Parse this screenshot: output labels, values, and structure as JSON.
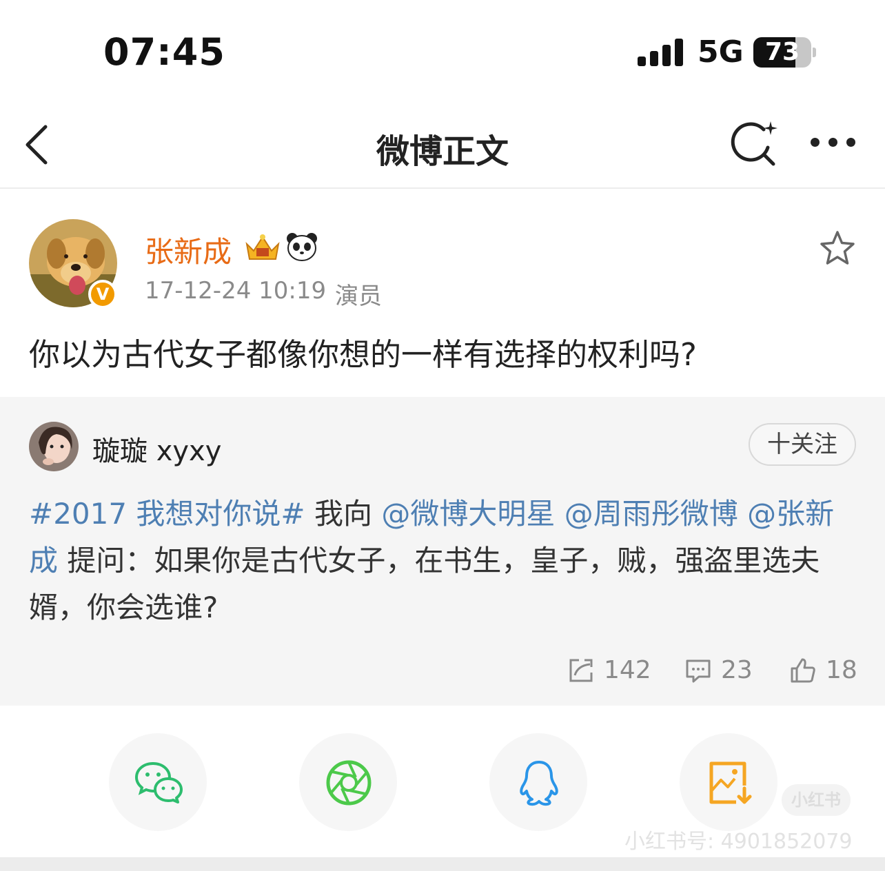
{
  "status_bar": {
    "time": "07:45",
    "network": "5G",
    "battery_level": "73",
    "battery_fraction": 0.73
  },
  "nav": {
    "title": "微博正文"
  },
  "post": {
    "author": "张新成",
    "verified_badge": "V",
    "timestamp": "17-12-24 10:19",
    "source": "演员",
    "text": "你以为古代女子都像你想的一样有选择的权利吗?"
  },
  "repost": {
    "author": "璇璇 xyxy",
    "follow_label": "十关注",
    "hashtag": "#2017 我想对你说#",
    "text_part1": " 我向 ",
    "mention1": "@微博大明星",
    "mention2": "@周雨彤微博",
    "mention3": "@张新成",
    "text_part2": " 提问：如果你是古代女子，在书生，皇子，贼，强盗里选夫婿，你会选谁?",
    "reposts": "142",
    "comments": "23",
    "likes": "18"
  },
  "share": {
    "icons": [
      "wechat-icon",
      "moments-icon",
      "qq-icon",
      "save-image-icon"
    ],
    "colors": {
      "wechat": "#2dbd6e",
      "moments": "#4cc94a",
      "qq": "#2a95e8",
      "save": "#f5a623"
    }
  },
  "watermark": {
    "badge": "小红书",
    "text": "小红书号: 4901852079"
  },
  "colors": {
    "author_name": "#e86b16",
    "link": "#4e7fb3",
    "verified": "#f29a00"
  }
}
